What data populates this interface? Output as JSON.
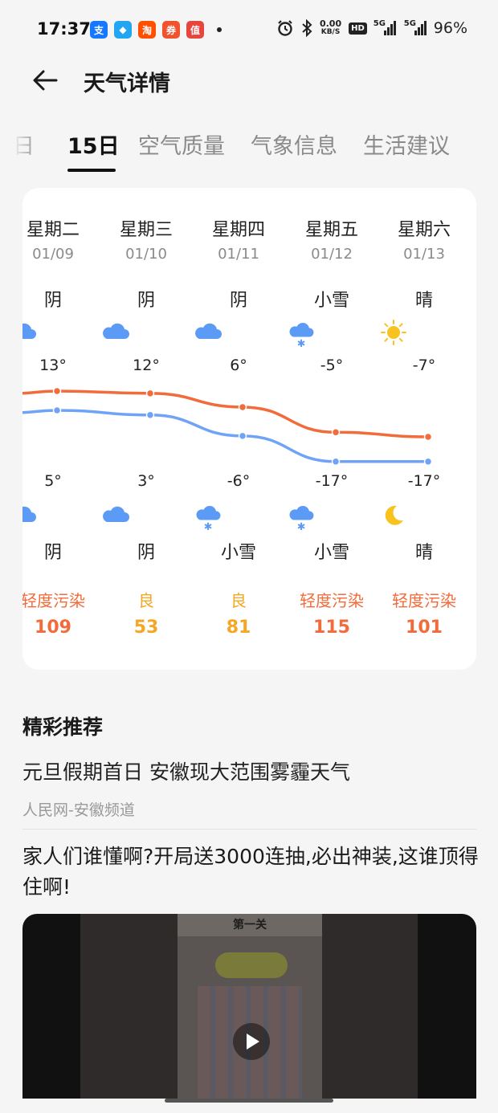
{
  "status_bar": {
    "time": "17:37",
    "apps": [
      {
        "icon": "alipay-icon",
        "glyph": "支",
        "color": "#1677ff"
      },
      {
        "icon": "bird-app-icon",
        "glyph": "◆",
        "color": "#22a6f2"
      },
      {
        "icon": "taobao-icon",
        "glyph": "淘",
        "color": "#ff5000"
      },
      {
        "icon": "shopping-app-icon",
        "glyph": "券",
        "color": "#f0522d"
      },
      {
        "icon": "value-app-icon",
        "glyph": "值",
        "color": "#e8453c"
      }
    ],
    "speed_value": "0.00",
    "speed_unit": "KB/S",
    "hd_label": "HD",
    "network1": "5G",
    "network2": "5G",
    "battery": "96%"
  },
  "header": {
    "title": "天气详情"
  },
  "tabs": [
    {
      "label": "日",
      "active": false
    },
    {
      "label": "15日",
      "active": true
    },
    {
      "label": "空气质量",
      "active": false
    },
    {
      "label": "气象信息",
      "active": false
    },
    {
      "label": "生活建议",
      "active": false
    }
  ],
  "forecast": [
    {
      "weekday": "星期二",
      "date": "01/09",
      "day_cond": "阴",
      "day_icon": "cloud-icon",
      "high": "13°",
      "low": "5°",
      "night_icon": "cloud-icon",
      "night_cond": "阴",
      "aqi_label": "轻度污染",
      "aqi_value": "109",
      "aqi_color": "#f26b3a"
    },
    {
      "weekday": "星期三",
      "date": "01/10",
      "day_cond": "阴",
      "day_icon": "cloud-icon",
      "high": "12°",
      "low": "3°",
      "night_icon": "cloud-icon",
      "night_cond": "阴",
      "aqi_label": "良",
      "aqi_value": "53",
      "aqi_color": "#f5a623"
    },
    {
      "weekday": "星期四",
      "date": "01/11",
      "day_cond": "阴",
      "day_icon": "cloud-icon",
      "high": "6°",
      "low": "-6°",
      "night_icon": "snow-icon",
      "night_cond": "小雪",
      "aqi_label": "良",
      "aqi_value": "81",
      "aqi_color": "#f5a623"
    },
    {
      "weekday": "星期五",
      "date": "01/12",
      "day_cond": "小雪",
      "day_icon": "snow-icon",
      "high": "-5°",
      "low": "-17°",
      "night_icon": "snow-icon",
      "night_cond": "小雪",
      "aqi_label": "轻度污染",
      "aqi_value": "115",
      "aqi_color": "#f26b3a"
    },
    {
      "weekday": "星期六",
      "date": "01/13",
      "day_cond": "晴",
      "day_icon": "sun-icon",
      "high": "-7°",
      "low": "-17°",
      "night_icon": "moon-icon",
      "night_cond": "晴",
      "aqi_label": "轻度污染",
      "aqi_value": "101",
      "aqi_color": "#f26b3a"
    }
  ],
  "colors": {
    "high_line": "#f26b3a",
    "low_line": "#6fa3f7",
    "cloud": "#5b9bf5",
    "sun": "#f8c21f",
    "moon": "#f8c21f"
  },
  "recommend": {
    "title": "精彩推荐",
    "news1_title": "元旦假期首日 安徽现大范围雾霾天气",
    "news1_source": "人民网-安徽频道",
    "news2_title": "家人们谁懂啊?开局送3000连抽,必出神装,这谁顶得住啊!",
    "video_caption": "第一关"
  }
}
